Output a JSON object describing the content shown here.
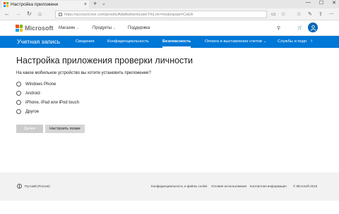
{
  "browser": {
    "tab_title": "Настройка приложени",
    "tab_close": "×",
    "new_tab": "+",
    "tab_list": "⌄",
    "window_controls": [
      "—",
      "☐",
      "✕"
    ],
    "url_host": "https://account.live.com",
    "url_path": "/proofs/AddAuthenticatorTrkLmr=mx&mpopt=CoEA",
    "nav_back": "←",
    "nav_forward": "→",
    "nav_refresh": "↻",
    "nav_home": "⌂"
  },
  "ms_header": {
    "brand": "Microsoft",
    "nav": [
      {
        "label": "Магазин",
        "has_menu": true
      },
      {
        "label": "Продукты",
        "has_menu": true
      },
      {
        "label": "Поддержка",
        "has_menu": false
      }
    ],
    "search_icon": "⚲",
    "cart_icon": "🛒"
  },
  "account_nav": {
    "title": "Учетная запись",
    "items": [
      {
        "label": "Сведения",
        "active": false
      },
      {
        "label": "Конфиденциальность",
        "active": false
      },
      {
        "label": "Безопасность",
        "active": true
      },
      {
        "label": "Оплата и выставление счетов",
        "active": false,
        "has_menu": true
      },
      {
        "label": "Службы и подп",
        "active": false
      }
    ],
    "scroll_arrow": "›"
  },
  "main": {
    "title": "Настройка приложения проверки личности",
    "question": "На какое мобильное устройство вы хотите установить приложение?",
    "options": [
      "Windows Phone",
      "Android",
      "iPhone, iPad или iPod touch",
      "Другое"
    ],
    "next_button": "Далее",
    "later_button": "Настроить позже"
  },
  "footer": {
    "locale": "Русский (Россия)",
    "links": [
      "Конфиденциальность и файлы cookie",
      "Условия использования",
      "Контактная информация",
      "© Microsoft 2018"
    ]
  },
  "colors": {
    "accent": "#0078d7",
    "avatar": "#0067b8",
    "footer_bg": "#f2f2f2"
  }
}
